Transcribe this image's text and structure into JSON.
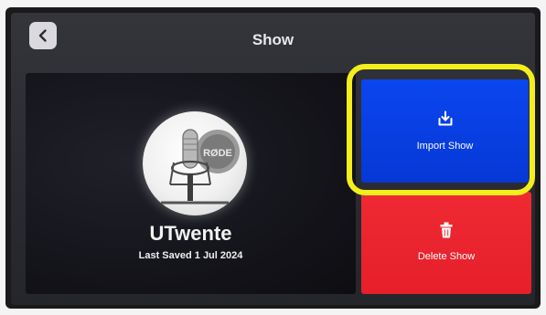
{
  "header": {
    "title": "Show",
    "back_icon": "chevron-left-icon"
  },
  "show": {
    "name": "UTwente",
    "last_saved": "Last Saved 1 Jul 2024",
    "logo_text": "RØDE"
  },
  "actions": {
    "import_label": "Import Show",
    "import_icon": "download-tray-icon",
    "delete_label": "Delete Show",
    "delete_icon": "trash-icon"
  },
  "colors": {
    "import": "#0a46ee",
    "delete": "#ef2a33",
    "highlight": "#f4ee1c"
  }
}
